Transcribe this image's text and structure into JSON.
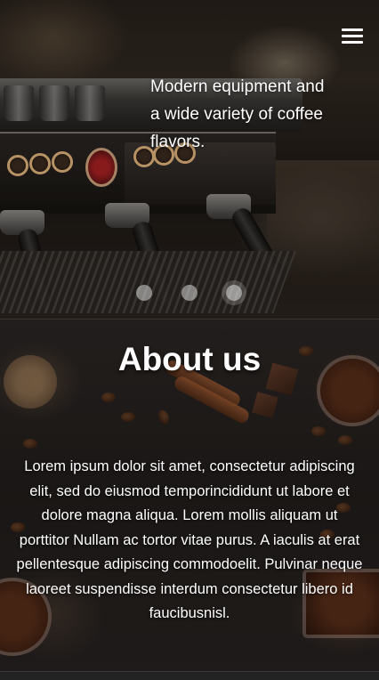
{
  "header": {
    "menu_icon": "hamburger-menu-icon"
  },
  "hero": {
    "caption": "Modern equipment and a wide variety of coffee flavors.",
    "slides_total": 3,
    "active_slide": 3
  },
  "about": {
    "title": "About us",
    "text": "Lorem ipsum dolor sit amet, consectetur adipiscing elit, sed do eiusmod temporincididunt ut labore et dolore magna aliqua. Lorem mollis aliquam ut porttitor Nullam ac tortor vitae purus. A iaculis at erat pellentesque adipiscing commodoelit. Pulvinar neque laoreet suspendisse interdum consectetur libero id faucibusnisl."
  },
  "colors": {
    "text": "#ffffff",
    "background": "#1a1614"
  }
}
